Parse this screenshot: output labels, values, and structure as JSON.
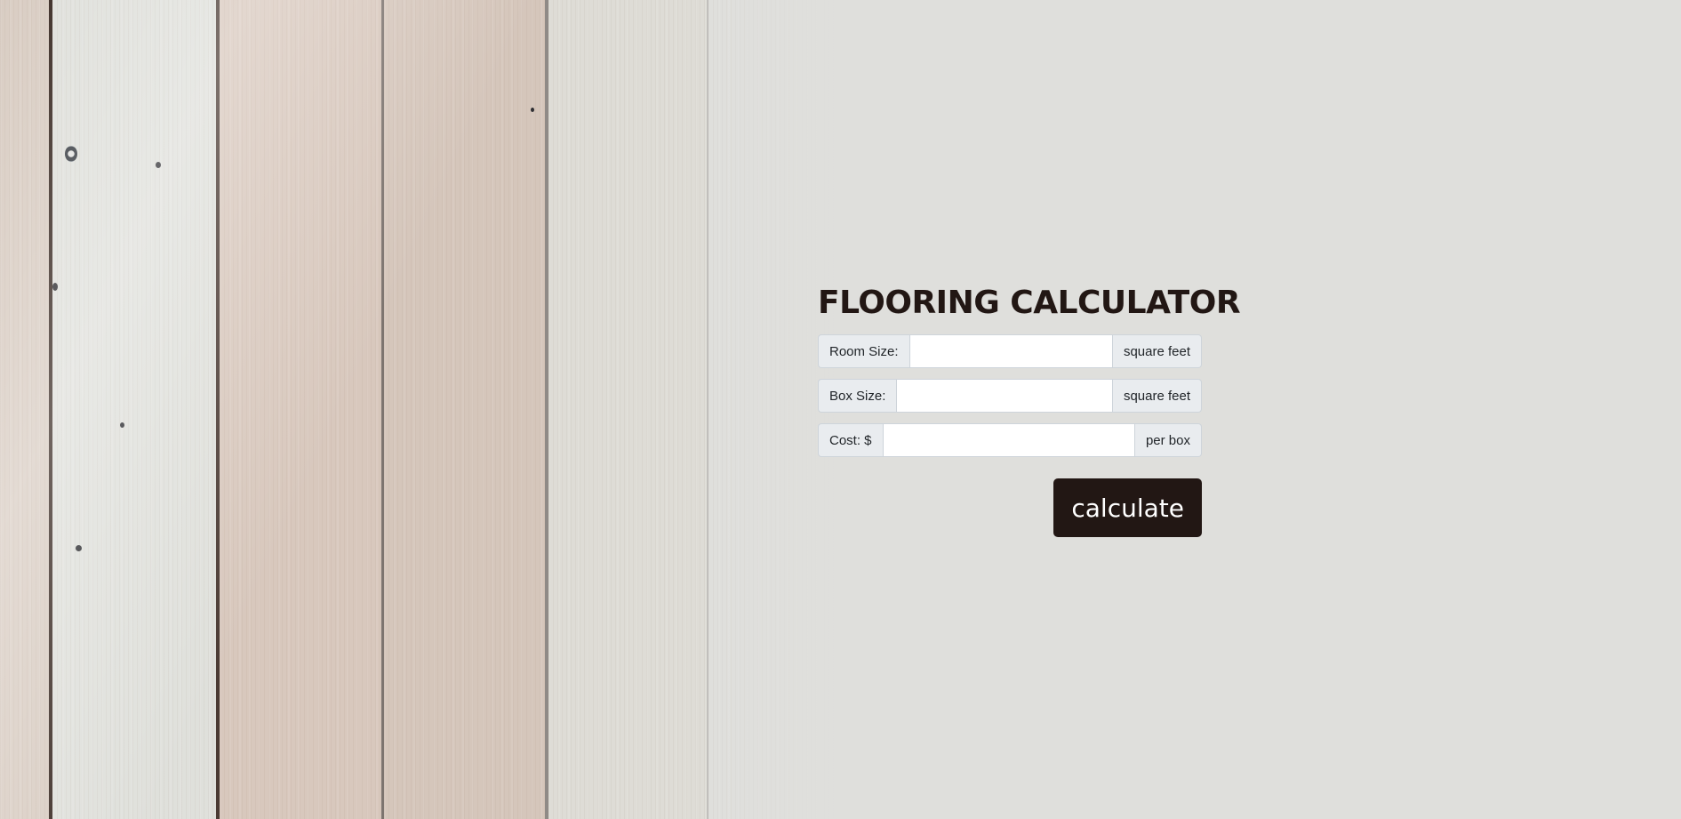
{
  "page": {
    "title": "FLOORING CALCULATOR"
  },
  "form": {
    "room_size": {
      "label": "Room Size:",
      "value": "",
      "unit": "square feet"
    },
    "box_size": {
      "label": "Box Size:",
      "value": "",
      "unit": "square feet"
    },
    "cost": {
      "label": "Cost: $",
      "value": "",
      "unit": "per box"
    },
    "submit_label": "calculate"
  },
  "colors": {
    "brand_dark": "#221714",
    "background": "#dfdfdc"
  }
}
